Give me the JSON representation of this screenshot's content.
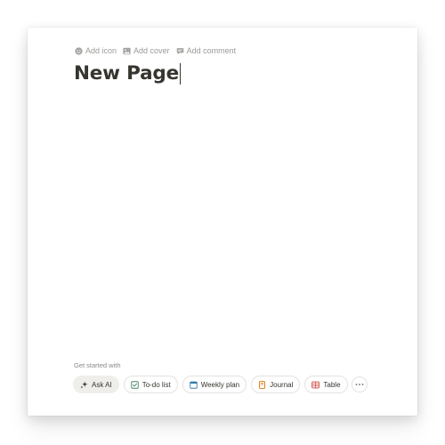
{
  "page": {
    "actions": [
      {
        "label": "Add icon",
        "icon": "smiley-icon"
      },
      {
        "label": "Add cover",
        "icon": "image-icon"
      },
      {
        "label": "Add comment",
        "icon": "comment-icon"
      }
    ],
    "title": "New Page"
  },
  "get_started": {
    "label": "Get started with",
    "options": [
      {
        "label": "Ask AI",
        "icon": "sparkle-icon"
      },
      {
        "label": "To-do list",
        "icon": "checkbox-icon",
        "color": "#448361"
      },
      {
        "label": "Weekly plan",
        "icon": "calendar-icon",
        "color": "#337ea9"
      },
      {
        "label": "Journal",
        "icon": "book-icon",
        "color": "#d9730d"
      },
      {
        "label": "Table",
        "icon": "table-icon",
        "color": "#d44c47"
      }
    ],
    "more_icon": "more-horizontal-icon"
  },
  "colors": {
    "text": "#37352f",
    "muted": "#9b9a97",
    "chip_border": "#e3e2df",
    "ai_chip_bg": "#efeeeb"
  }
}
